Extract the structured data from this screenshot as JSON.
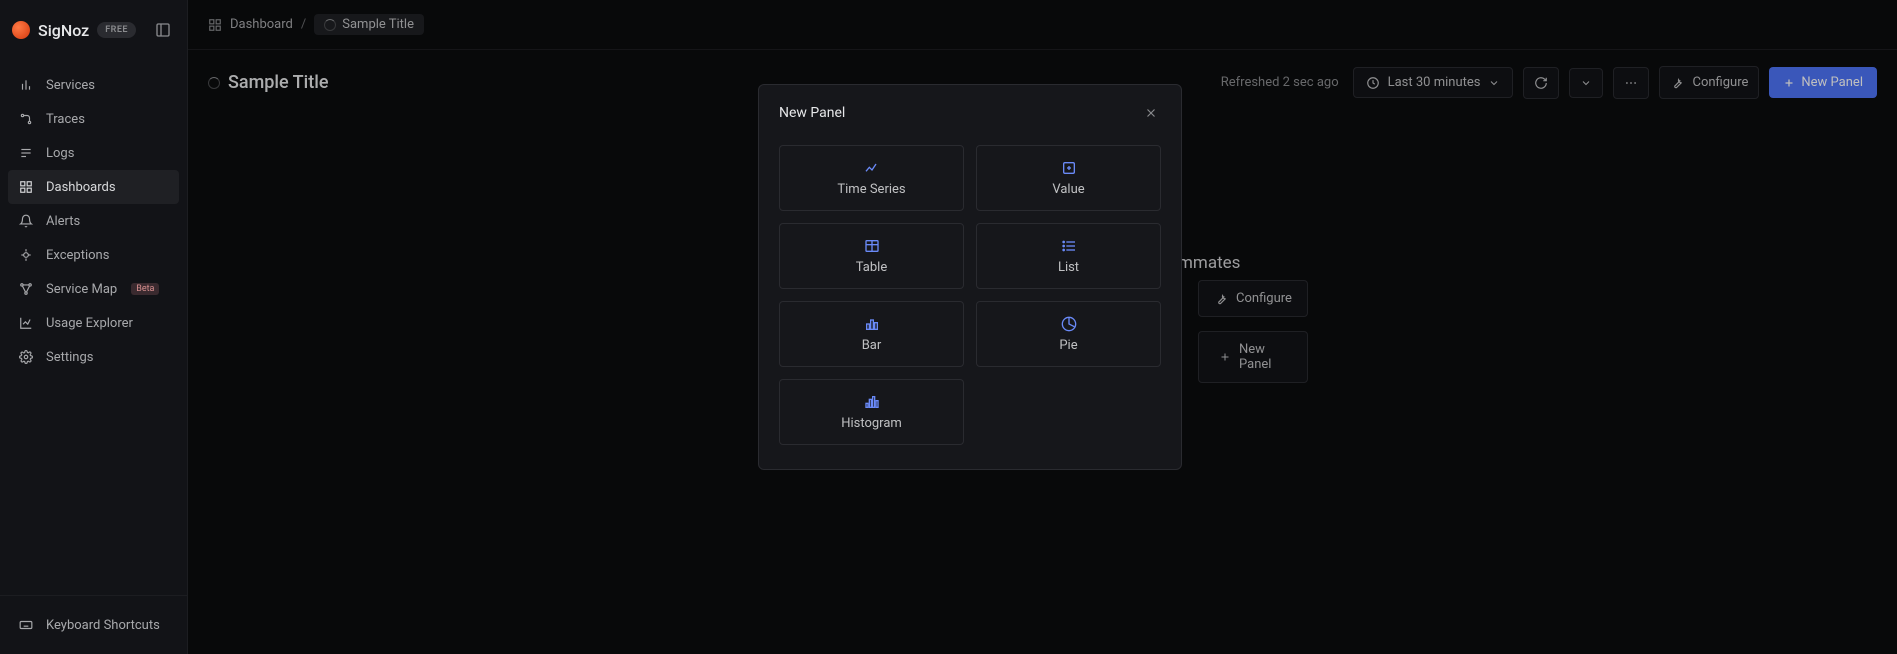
{
  "brand": {
    "name": "SigNoz",
    "plan": "FREE"
  },
  "sidebar": {
    "items": [
      {
        "label": "Services"
      },
      {
        "label": "Traces"
      },
      {
        "label": "Logs"
      },
      {
        "label": "Dashboards"
      },
      {
        "label": "Alerts"
      },
      {
        "label": "Exceptions"
      },
      {
        "label": "Service Map",
        "badge": "Beta"
      },
      {
        "label": "Usage Explorer"
      },
      {
        "label": "Settings"
      }
    ],
    "footer": {
      "label": "Keyboard Shortcuts"
    }
  },
  "breadcrumb": {
    "root": "Dashboard",
    "separator": "/",
    "current": "Sample Title"
  },
  "header": {
    "title": "Sample Title",
    "refreshed": "Refreshed 2 sec ago",
    "time_range": "Last 30 minutes",
    "configure": "Configure",
    "new_panel": "New Panel"
  },
  "empty_state": {
    "heading_fragment": "mmates",
    "configure": "Configure",
    "new_panel": "New Panel"
  },
  "modal": {
    "title": "New Panel",
    "options": [
      {
        "label": "Time Series"
      },
      {
        "label": "Value"
      },
      {
        "label": "Table"
      },
      {
        "label": "List"
      },
      {
        "label": "Bar"
      },
      {
        "label": "Pie"
      },
      {
        "label": "Histogram"
      }
    ]
  }
}
